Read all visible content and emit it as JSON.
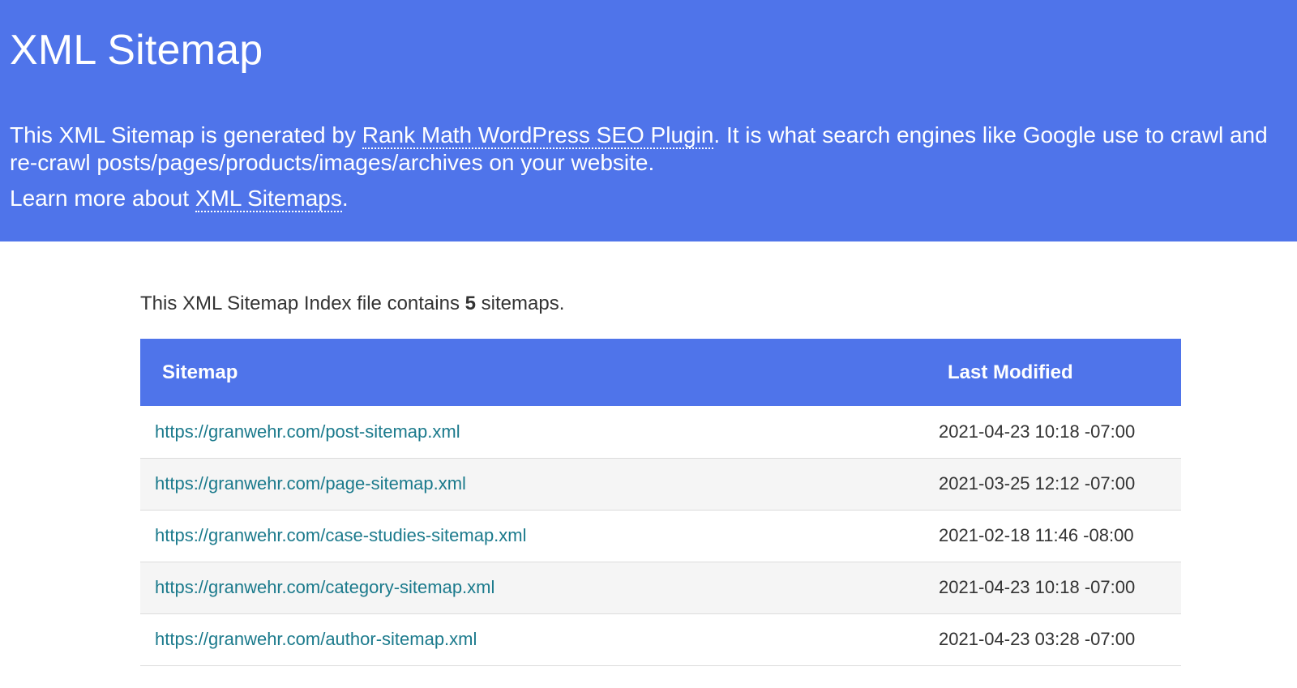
{
  "header": {
    "title": "XML Sitemap",
    "desc_before": "This XML Sitemap is generated by ",
    "plugin_link": "Rank Math WordPress SEO Plugin",
    "desc_after": ". It is what search engines like Google use to crawl and re-crawl posts/pages/products/images/archives on your website.",
    "learn_before": "Learn more about ",
    "learn_link": "XML Sitemaps",
    "learn_after": ".",
    "bg_color": "#4f74ea"
  },
  "summary": {
    "before": "This XML Sitemap Index file contains ",
    "count": "5",
    "after": " sitemaps."
  },
  "table": {
    "col_sitemap": "Sitemap",
    "col_modified": "Last Modified",
    "link_color": "#1b7a8c",
    "rows": [
      {
        "url": "https://granwehr.com/post-sitemap.xml",
        "modified": "2021-04-23 10:18 -07:00"
      },
      {
        "url": "https://granwehr.com/page-sitemap.xml",
        "modified": "2021-03-25 12:12 -07:00"
      },
      {
        "url": "https://granwehr.com/case-studies-sitemap.xml",
        "modified": "2021-02-18 11:46 -08:00"
      },
      {
        "url": "https://granwehr.com/category-sitemap.xml",
        "modified": "2021-04-23 10:18 -07:00"
      },
      {
        "url": "https://granwehr.com/author-sitemap.xml",
        "modified": "2021-04-23 03:28 -07:00"
      }
    ]
  }
}
